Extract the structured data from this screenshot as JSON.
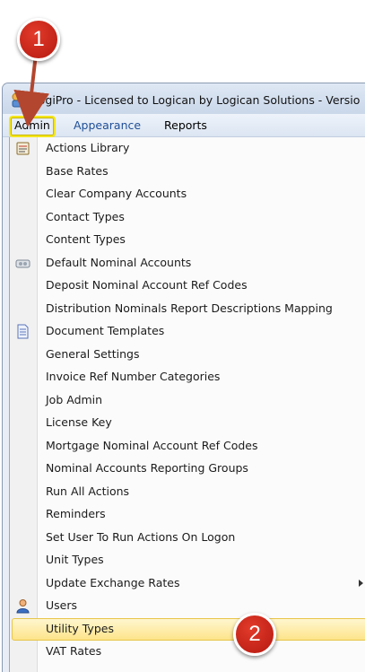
{
  "window": {
    "title": "LogiPro - Licensed to Logican by Logican Solutions - Versio"
  },
  "menubar": {
    "admin": "Admin",
    "appearance": "Appearance",
    "reports": "Reports"
  },
  "admin_menu": {
    "items": [
      {
        "label": "Actions Library",
        "icon": "actions-library-icon"
      },
      {
        "label": "Base Rates"
      },
      {
        "label": "Clear Company Accounts"
      },
      {
        "label": "Contact Types"
      },
      {
        "label": "Content Types"
      },
      {
        "label": "Default Nominal Accounts",
        "icon": "nominal-accounts-icon"
      },
      {
        "label": "Deposit Nominal Account Ref Codes"
      },
      {
        "label": "Distribution Nominals Report Descriptions Mapping"
      },
      {
        "label": "Document Templates",
        "icon": "document-icon"
      },
      {
        "label": "General Settings"
      },
      {
        "label": "Invoice Ref Number Categories"
      },
      {
        "label": "Job Admin"
      },
      {
        "label": "License Key"
      },
      {
        "label": "Mortgage Nominal Account Ref Codes"
      },
      {
        "label": "Nominal Accounts Reporting Groups"
      },
      {
        "label": "Run All Actions"
      },
      {
        "label": "Reminders"
      },
      {
        "label": "Set User To Run Actions On Logon"
      },
      {
        "label": "Unit Types"
      },
      {
        "label": "Update Exchange Rates",
        "submenu": true
      },
      {
        "label": "Users",
        "icon": "user-icon"
      },
      {
        "label": "Utility Types",
        "highlighted": true
      },
      {
        "label": "VAT Rates"
      }
    ]
  },
  "annotations": {
    "step1": "1",
    "step2": "2"
  },
  "colors": {
    "annotation_red": "#c8231a",
    "highlight_yellow": "#fde48a",
    "admin_outline": "#f4e61d"
  }
}
